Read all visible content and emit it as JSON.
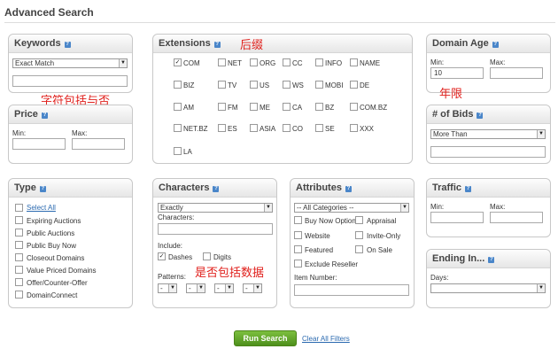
{
  "page_title": "Advanced Search",
  "help_icon": "?",
  "keywords": {
    "title": "Keywords",
    "match": "Exact Match",
    "note": "字符包括与否"
  },
  "price": {
    "title": "Price",
    "min": "Min:",
    "max": "Max:"
  },
  "extensions": {
    "title": "Extensions",
    "note": "后缀",
    "items": [
      {
        "label": "COM",
        "checked": true
      },
      {
        "label": "NET"
      },
      {
        "label": "ORG"
      },
      {
        "label": "CC"
      },
      {
        "label": "INFO"
      },
      {
        "label": "NAME"
      },
      {
        "label": "BIZ"
      },
      {
        "label": "TV"
      },
      {
        "label": "US"
      },
      {
        "label": "WS"
      },
      {
        "label": "MOBI"
      },
      {
        "label": "DE"
      },
      {
        "label": "AM"
      },
      {
        "label": "FM"
      },
      {
        "label": "ME"
      },
      {
        "label": "CA"
      },
      {
        "label": "BZ"
      },
      {
        "label": "COM.BZ"
      },
      {
        "label": "NET.BZ"
      },
      {
        "label": "ES"
      },
      {
        "label": "ASIA"
      },
      {
        "label": "CO"
      },
      {
        "label": "SE"
      },
      {
        "label": "XXX"
      },
      {
        "label": "LA"
      }
    ]
  },
  "domain_age": {
    "title": "Domain Age",
    "min": "Min:",
    "max": "Max:",
    "min_value": "10",
    "note": "年限"
  },
  "bids": {
    "title": "# of Bids",
    "option": "More Than"
  },
  "type": {
    "title": "Type",
    "select_all": "Select All",
    "items": [
      "Expiring Auctions",
      "Public Auctions",
      "Public Buy Now",
      "Closeout Domains",
      "Value Priced Domains",
      "Offer/Counter-Offer",
      "DomainConnect"
    ]
  },
  "characters": {
    "title": "Characters",
    "option": "Exactly",
    "chars_label": "Characters:",
    "include_label": "Include:",
    "dashes": "Dashes",
    "digits": "Digits",
    "patterns_label": "Patterns:",
    "pattern_value": "-",
    "note": "是否包括数据"
  },
  "attributes": {
    "title": "Attributes",
    "category": "-- All Categories --",
    "buy_now": "Buy Now Option",
    "appraisal": "Appraisal",
    "website": "Website",
    "invite_only": "Invite-Only",
    "featured": "Featured",
    "on_sale": "On Sale",
    "exclude_reseller": "Exclude Reseller",
    "item_number": "Item Number:"
  },
  "traffic": {
    "title": "Traffic",
    "min": "Min:",
    "max": "Max:"
  },
  "ending": {
    "title": "Ending In...",
    "days": "Days:"
  },
  "actions": {
    "search": "Run Search",
    "clear": "Clear All Filters"
  }
}
